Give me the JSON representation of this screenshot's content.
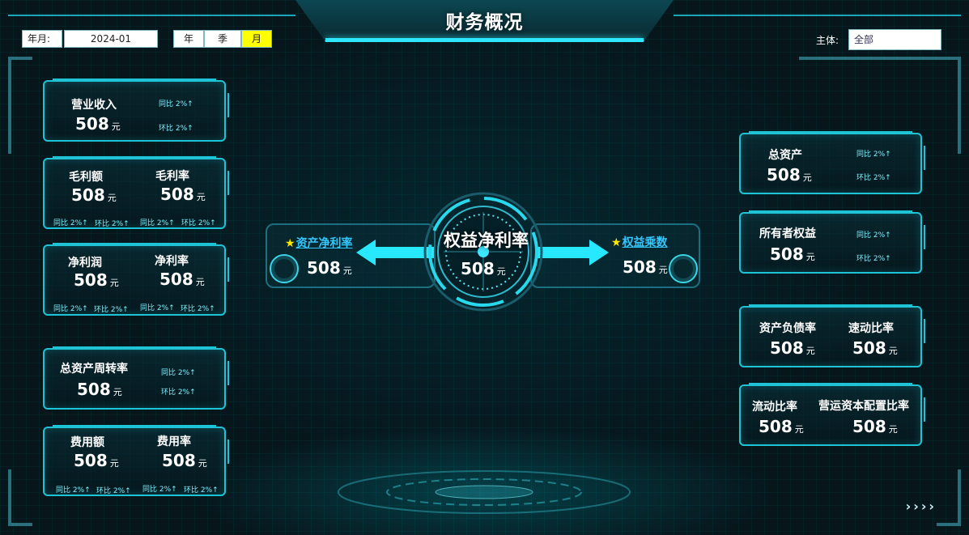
{
  "header": {
    "title": "财务概况"
  },
  "controls": {
    "ym_label": "年月:",
    "ym_value": "2024-01",
    "period_tabs": [
      "年",
      "季",
      "月"
    ],
    "period_active": "月",
    "entity_label": "主体:",
    "entity_value": "全部"
  },
  "colors": {
    "accent": "#1ec3d6",
    "highlight": "#ffff00",
    "link": "#33c7ff",
    "star": "#ffe600"
  },
  "left_cards": {
    "revenue": {
      "label": "营业收入",
      "value": "508",
      "unit": "元",
      "yoy": "同比 2%↑",
      "mom": "环比 2%↑"
    },
    "gross": {
      "label_a": "毛利额",
      "value_a": "508",
      "label_b": "毛利率",
      "value_b": "508",
      "unit": "元",
      "yoy_a": "同比 2%↑",
      "mom_a": "环比 2%↑",
      "yoy_b": "同比 2%↑",
      "mom_b": "环比 2%↑"
    },
    "net": {
      "label_a": "净利润",
      "value_a": "508",
      "label_b": "净利率",
      "value_b": "508",
      "unit": "元",
      "yoy_a": "同比 2%↑",
      "mom_a": "环比 2%↑",
      "yoy_b": "同比 2%↑",
      "mom_b": "环比 2%↑"
    },
    "turnover": {
      "label": "总资产周转率",
      "value": "508",
      "unit": "元",
      "yoy": "同比 2%↑",
      "mom": "环比 2%↑"
    },
    "expense": {
      "label_a": "费用额",
      "value_a": "508",
      "label_b": "费用率",
      "value_b": "508",
      "unit": "元",
      "yoy_a": "同比 2%↑",
      "mom_a": "环比 2%↑",
      "yoy_b": "同比 2%↑",
      "mom_b": "环比 2%↑"
    }
  },
  "center": {
    "main": {
      "label": "权益净利率",
      "value": "508",
      "unit": "元"
    },
    "left": {
      "star": "★",
      "label": "资产净利率",
      "value": "508",
      "unit": "元"
    },
    "right": {
      "star": "★",
      "label": "权益乘数",
      "value": "508",
      "unit": "元"
    }
  },
  "right_cards": {
    "total_assets": {
      "label": "总资产",
      "value": "508",
      "unit": "元",
      "yoy": "同比 2%↑",
      "mom": "环比 2%↑"
    },
    "equity": {
      "label": "所有者权益",
      "value": "508",
      "unit": "元",
      "yoy": "同比 2%↑",
      "mom": "环比 2%↑"
    },
    "debt": {
      "label_a": "资产负债率",
      "value_a": "508",
      "label_b": "速动比率",
      "value_b": "508",
      "unit": "元"
    },
    "liquidity": {
      "label_a": "流动比率",
      "value_a": "508",
      "label_b": "营运资本配置比率",
      "value_b": "508",
      "unit": "元"
    }
  },
  "footer": {
    "more_glyph": "››››"
  }
}
